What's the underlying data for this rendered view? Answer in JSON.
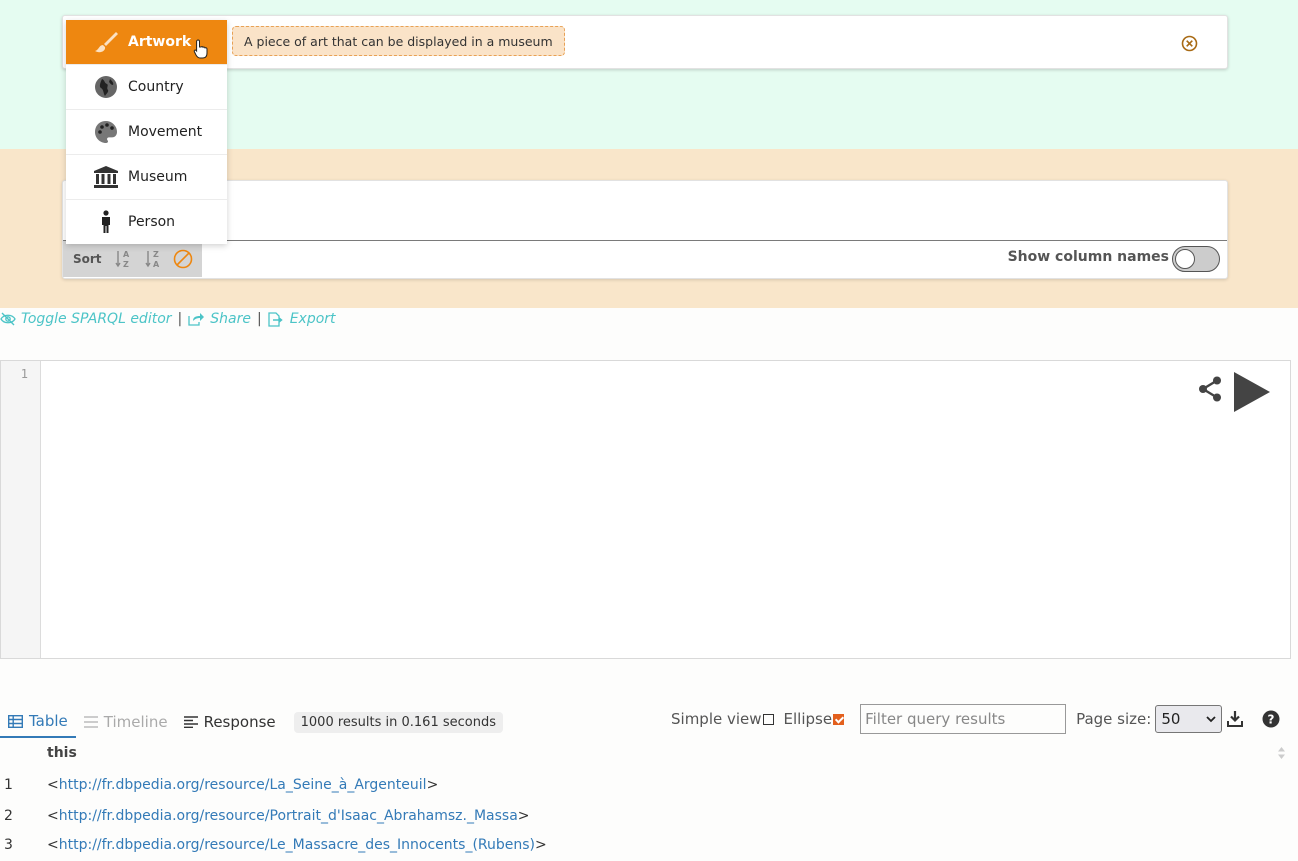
{
  "selector": {
    "selected_entity": "Artwork",
    "description": "A piece of art that can be displayed in a museum",
    "options": [
      {
        "label": "Artwork",
        "icon": "paintbrush-icon"
      },
      {
        "label": "Country",
        "icon": "globe-icon"
      },
      {
        "label": "Movement",
        "icon": "palette-icon"
      },
      {
        "label": "Museum",
        "icon": "museum-icon"
      },
      {
        "label": "Person",
        "icon": "person-icon"
      }
    ]
  },
  "result_panel": {
    "sort_label": "Sort",
    "show_column_names_label": "Show column names",
    "show_column_names": false
  },
  "links": {
    "toggle_sparql": "Toggle SPARQL editor",
    "share": "Share",
    "export": "Export",
    "separator": "|"
  },
  "editor": {
    "line_numbers": [
      "1"
    ]
  },
  "results": {
    "tabs": [
      {
        "label": "Table",
        "state": "active"
      },
      {
        "label": "Timeline",
        "state": "disabled"
      },
      {
        "label": "Response",
        "state": "normal"
      }
    ],
    "summary": "1000 results in 0.161 seconds",
    "simple_view_label": "Simple view",
    "simple_view_checked": false,
    "ellipse_label": "Ellipse",
    "ellipse_checked": true,
    "filter_placeholder": "Filter query results",
    "page_size_label": "Page size:",
    "page_size_value": "50",
    "column_header": "this",
    "rows": [
      {
        "index": "1",
        "open": "<",
        "uri": "http://fr.dbpedia.org/resource/La_Seine_à_Argenteuil",
        "close": ">"
      },
      {
        "index": "2",
        "open": "<",
        "uri": "http://fr.dbpedia.org/resource/Portrait_d'Isaac_Abrahamsz._Massa",
        "close": ">"
      },
      {
        "index": "3",
        "open": "<",
        "uri": "http://fr.dbpedia.org/resource/Le_Massacre_des_Innocents_(Rubens)",
        "close": ">"
      }
    ]
  },
  "colors": {
    "accent_orange": "#ee8710",
    "link_teal": "#4cc4c7",
    "link_blue": "#337ab7",
    "band_top": "#e5fcf1",
    "band_mid": "#f9e6ca"
  }
}
